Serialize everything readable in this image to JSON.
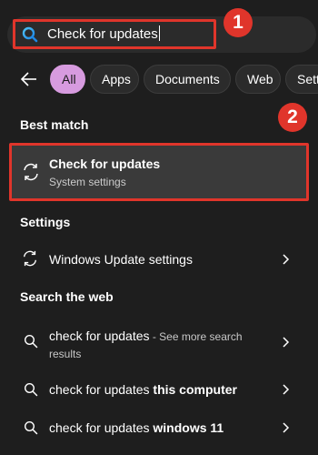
{
  "search": {
    "value": "Check for updates"
  },
  "filters": {
    "back": "back",
    "items": [
      "All",
      "Apps",
      "Documents",
      "Web",
      "Sett"
    ]
  },
  "sections": {
    "best_match": "Best match",
    "settings": "Settings",
    "web": "Search the web"
  },
  "best_match_item": {
    "title": "Check for updates",
    "subtitle": "System settings"
  },
  "settings_items": [
    {
      "label": "Windows Update settings"
    }
  ],
  "web_items": [
    {
      "query": "check for updates",
      "bold": "",
      "suffix": " - See more search",
      "suffix2": "results"
    },
    {
      "query": "check for updates ",
      "bold": "this computer"
    },
    {
      "query": "check for updates ",
      "bold": "windows 11"
    }
  ],
  "callouts": [
    "1",
    "2"
  ],
  "colors": {
    "accent_chip": "#d79bdf",
    "callout": "#e0352b",
    "background": "#1e1e1e"
  }
}
